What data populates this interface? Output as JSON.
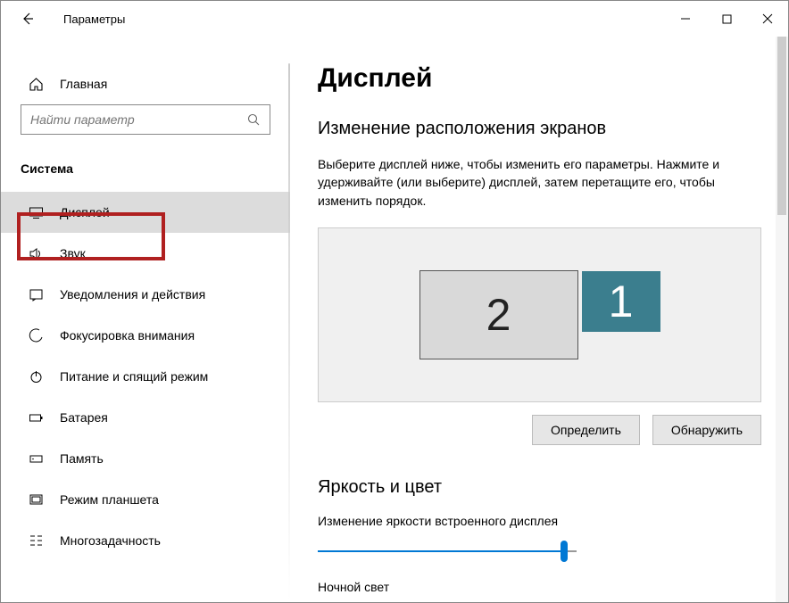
{
  "window": {
    "title": "Параметры"
  },
  "sidebar": {
    "home_label": "Главная",
    "search_placeholder": "Найти параметр",
    "section_label": "Система",
    "items": [
      {
        "label": "Дисплей"
      },
      {
        "label": "Звук"
      },
      {
        "label": "Уведомления и действия"
      },
      {
        "label": "Фокусировка внимания"
      },
      {
        "label": "Питание и спящий режим"
      },
      {
        "label": "Батарея"
      },
      {
        "label": "Память"
      },
      {
        "label": "Режим планшета"
      },
      {
        "label": "Многозадачность"
      }
    ]
  },
  "main": {
    "page_title": "Дисплей",
    "rearrange_heading": "Изменение расположения экранов",
    "rearrange_instruction": "Выберите дисплей ниже, чтобы изменить его параметры. Нажмите и удерживайте (или выберите) дисплей, затем перетащите его, чтобы изменить порядок.",
    "monitor2_label": "2",
    "monitor1_label": "1",
    "identify_label": "Определить",
    "detect_label": "Обнаружить",
    "brightness_section_heading": "Яркость и цвет",
    "brightness_slider_label": "Изменение яркости встроенного дисплея",
    "brightness_value_percent": 95,
    "night_light_label": "Ночной свет"
  }
}
